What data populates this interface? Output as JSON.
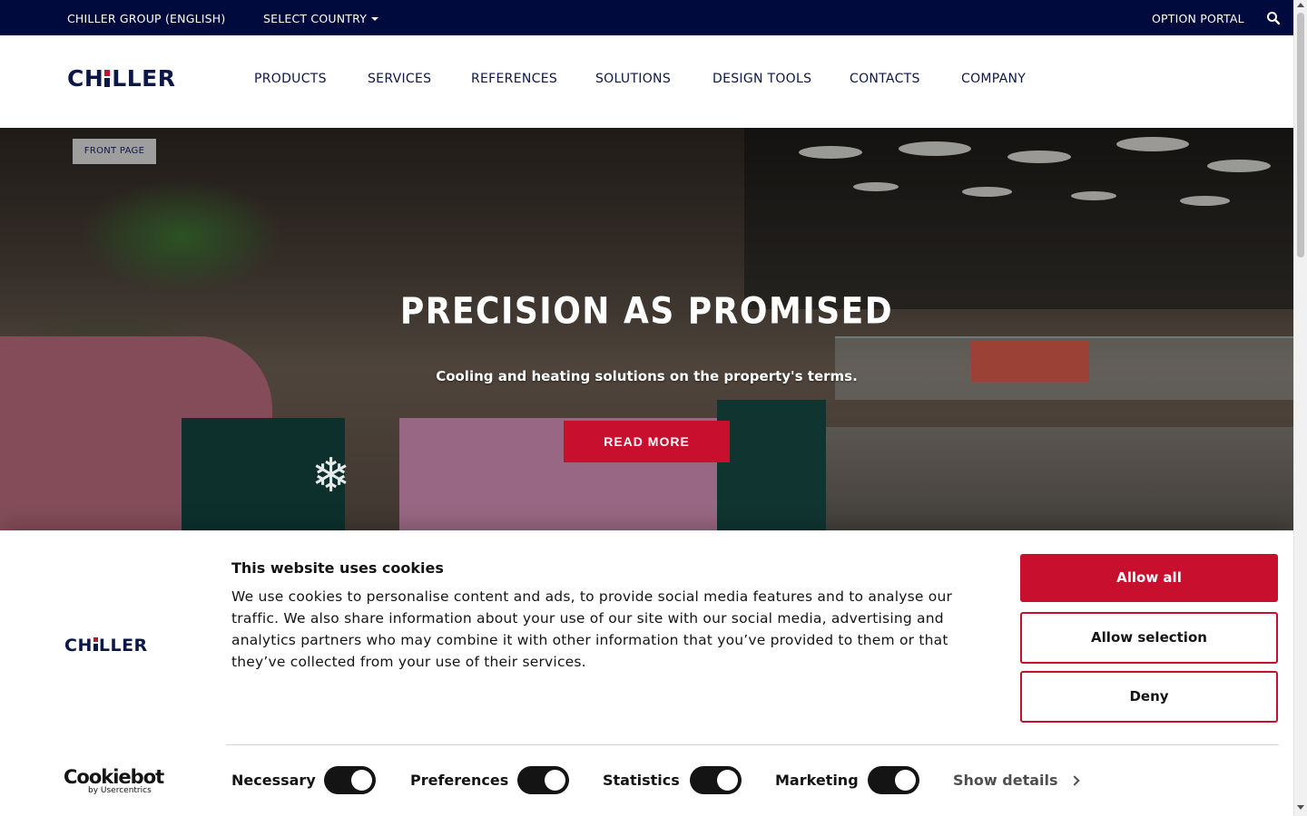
{
  "topbar": {
    "group_label": "CHILLER GROUP (ENGLISH)",
    "country_label": "SELECT COUNTRY",
    "portal_label": "OPTION PORTAL",
    "search_icon": "search-icon"
  },
  "header": {
    "logo_text_pre": "CH",
    "logo_text_post": "LLER",
    "nav": [
      "PRODUCTS",
      "SERVICES",
      "REFERENCES",
      "SOLUTIONS",
      "DESIGN TOOLS",
      "CONTACTS",
      "COMPANY"
    ]
  },
  "hero": {
    "badge": "FRONT PAGE",
    "title": "PRECISION AS PROMISED",
    "subtitle": "Cooling and heating solutions on the property's terms.",
    "button": "READ MORE"
  },
  "cookie": {
    "title": "This website uses cookies",
    "description": "We use cookies to personalise content and ads, to provide social media features and to analyse our traffic. We also share information about your use of our site with our social media, advertising and analytics partners who may combine it with other information that you’ve provided to them or that they’ve collected from your use of their services.",
    "allow_all": "Allow all",
    "allow_selection": "Allow selection",
    "deny": "Deny",
    "toggles": [
      {
        "label": "Necessary",
        "on": true
      },
      {
        "label": "Preferences",
        "on": true
      },
      {
        "label": "Statistics",
        "on": true
      },
      {
        "label": "Marketing",
        "on": true
      }
    ],
    "show_details": "Show details",
    "provider": "Cookiebot",
    "provider_by": "by Usercentrics"
  },
  "colors": {
    "navy": "#000a3c",
    "brand_red": "#c8102e"
  }
}
